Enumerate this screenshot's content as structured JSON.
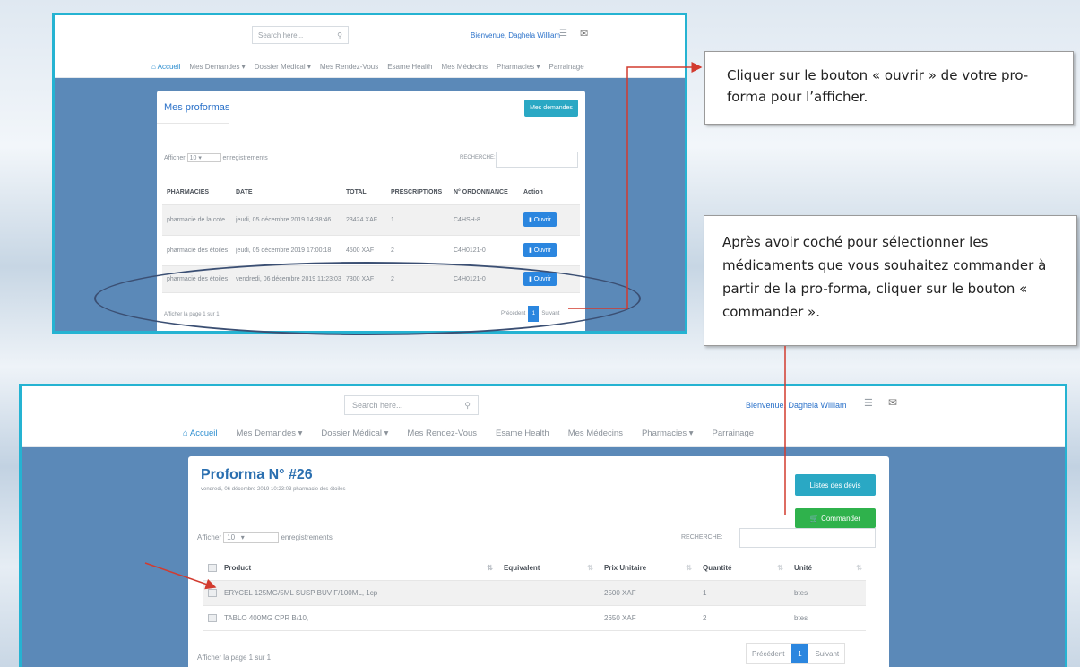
{
  "top_screen": {
    "search_placeholder": "Search here...",
    "welcome": "Bienvenue, Daghela William",
    "nav": [
      {
        "label": "Accueil"
      },
      {
        "label": "Mes Demandes ▾"
      },
      {
        "label": "Dossier Médical ▾"
      },
      {
        "label": "Mes Rendez-Vous"
      },
      {
        "label": "Esame Health"
      },
      {
        "label": "Mes Médecins"
      },
      {
        "label": "Pharmacies ▾"
      },
      {
        "label": "Parrainage"
      }
    ],
    "card_title": "Mes proformas",
    "new_request_button": "Mes demandes",
    "show_label": "Afficher",
    "show_value": "10",
    "entries_label": "enregistrements",
    "search_label": "RECHERCHE:",
    "columns": [
      "PHARMACIES",
      "DATE",
      "TOTAL",
      "PRESCRIPTIONS",
      "N° ORDONNANCE",
      "Action"
    ],
    "rows": [
      {
        "pharmacy": "pharmacie de la cote",
        "date": "jeudi, 05 décembre 2019 14:38:46",
        "total": "23424 XAF",
        "prescriptions": "1",
        "ordonnance": "C4HSH-8",
        "action": "Ouvrir"
      },
      {
        "pharmacy": "pharmacie des étoiles",
        "date": "jeudi, 05 décembre 2019 17:00:18",
        "total": "4500 XAF",
        "prescriptions": "2",
        "ordonnance": "C4H0121-0",
        "action": "Ouvrir"
      },
      {
        "pharmacy": "pharmacie des étoiles",
        "date": "vendredi, 06 décembre 2019 11:23:03",
        "total": "7300 XAF",
        "prescriptions": "2",
        "ordonnance": "C4H0121-0",
        "action": "Ouvrir"
      }
    ],
    "footer": "Afficher la page 1 sur 1",
    "prev": "Précédent",
    "page": "1",
    "next": "Suivant"
  },
  "bottom_screen": {
    "search_placeholder": "Search here...",
    "welcome": "Bienvenue, Daghela William",
    "nav": [
      {
        "label": "Accueil"
      },
      {
        "label": "Mes Demandes ▾"
      },
      {
        "label": "Dossier Médical ▾"
      },
      {
        "label": "Mes Rendez-Vous"
      },
      {
        "label": "Esame Health"
      },
      {
        "label": "Mes Médecins"
      },
      {
        "label": "Pharmacies ▾"
      },
      {
        "label": "Parrainage"
      }
    ],
    "title": "Proforma N° #26",
    "subtitle": "vendredi, 06 décembre 2019 10:23:03 pharmacie des étoiles",
    "devis_button": "Listes des devis",
    "order_button": "Commander",
    "show_label": "Afficher",
    "show_value": "10",
    "entries_label": "enregistrements",
    "search_label": "RECHERCHE:",
    "columns": [
      "Product",
      "Equivalent",
      "Prix Unitaire",
      "Quantité",
      "Unité"
    ],
    "rows": [
      {
        "product": "ERYCEL 125MG/5ML SUSP BUV F/100ML, 1cp",
        "equivalent": "",
        "price": "2500 XAF",
        "quantity": "1",
        "unit": "btes"
      },
      {
        "product": "TABLO 400MG CPR B/10,",
        "equivalent": "",
        "price": "2650 XAF",
        "quantity": "2",
        "unit": "btes"
      }
    ],
    "footer": "Afficher la page 1 sur 1",
    "prev": "Précédent",
    "page": "1",
    "next": "Suivant"
  },
  "callouts": {
    "open_instruction": "Cliquer sur le bouton « ouvrir » de votre pro-forma pour l’afficher.",
    "order_instruction": "Après avoir coché pour sélectionner les médicaments que vous souhaitez commander à partir de la pro-forma, cliquer sur le bouton « commander »."
  },
  "colors": {
    "accent": "#25b3d2",
    "background": "#5b89b8",
    "primary": "#2b86df",
    "success": "#2fb24c",
    "arrow": "#d23b2f"
  }
}
